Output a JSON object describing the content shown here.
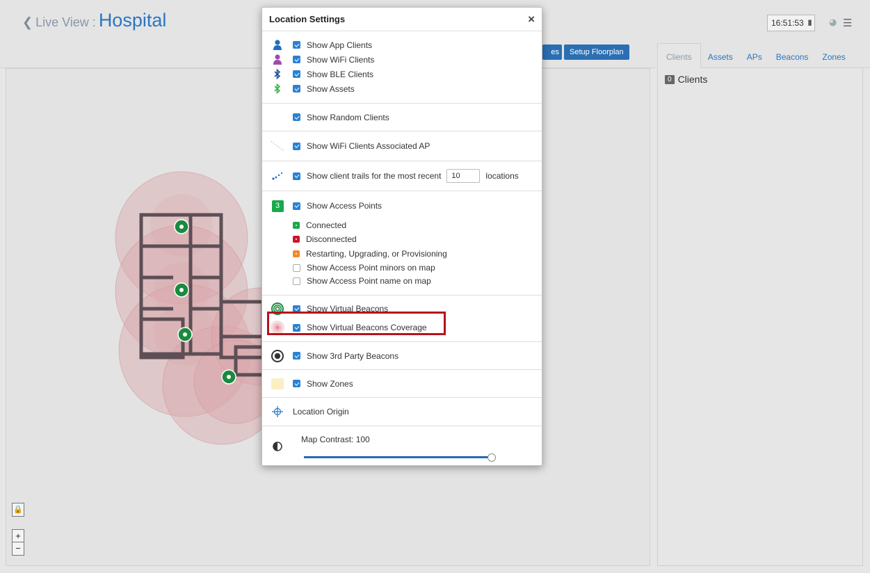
{
  "header": {
    "back_label": "Live View :",
    "site_name": "Hospital",
    "clock": "16:51:53",
    "pause_glyph": "II",
    "buttons": {
      "partial": "es",
      "setup_floorplan": "Setup Floorplan"
    }
  },
  "right_panel": {
    "tabs": [
      "Clients",
      "Assets",
      "APs",
      "Beacons",
      "Zones"
    ],
    "active_tab": "Clients",
    "client_count": "0",
    "client_label": "Clients"
  },
  "map_controls": {
    "lock_icon": "lock-icon",
    "zoom_in": "+",
    "zoom_out": "−"
  },
  "modal": {
    "title": "Location Settings",
    "close_glyph": "×",
    "clients": [
      {
        "label": "Show App Clients",
        "icon": "person-icon",
        "color": "#1d6fc2",
        "checked": true
      },
      {
        "label": "Show WiFi Clients",
        "icon": "person-icon",
        "color": "#a24ab0",
        "checked": true
      },
      {
        "label": "Show BLE Clients",
        "icon": "bluetooth-icon",
        "color": "#1a4fa0",
        "checked": true
      },
      {
        "label": "Show Assets",
        "icon": "bluetooth-icon",
        "color": "#39b54a",
        "checked": true
      }
    ],
    "random_clients": "Show Random Clients",
    "wifi_assoc_ap": "Show WiFi Clients Associated AP",
    "trails": {
      "label": "Show client trails for the most recent",
      "value": "10",
      "suffix": "locations"
    },
    "access_points": {
      "count_badge": "3",
      "label": "Show Access Points",
      "statuses": [
        {
          "label": "Connected",
          "color": "#1aa84c"
        },
        {
          "label": "Disconnected",
          "color": "#c9182b"
        },
        {
          "label": "Restarting, Upgrading, or Provisioning",
          "color": "#ee8a2f"
        }
      ],
      "minors": "Show Access Point minors on map",
      "names": "Show Access Point name on map"
    },
    "virtual_beacons": "Show Virtual Beacons",
    "virtual_beacons_coverage": "Show Virtual Beacons Coverage",
    "third_party_beacons": "Show 3rd Party Beacons",
    "zones": "Show Zones",
    "location_origin": "Location Origin",
    "map_contrast": {
      "label": "Map Contrast: 100",
      "value": 100
    }
  },
  "colors": {
    "accent": "#2a76c0",
    "highlight": "#b5121b",
    "checkbox": "#2a82d4"
  }
}
